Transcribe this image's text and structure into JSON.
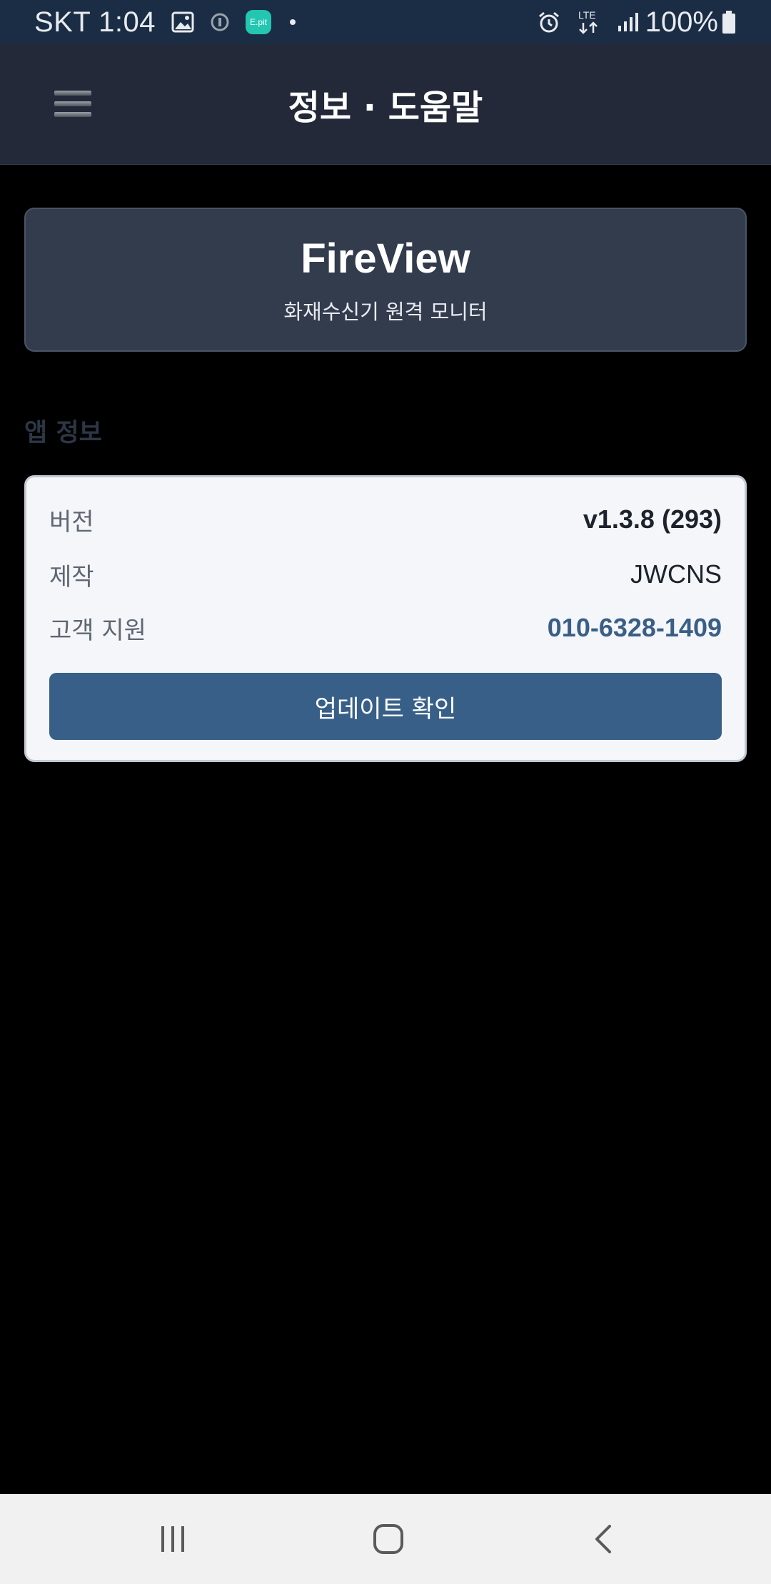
{
  "status_bar": {
    "carrier_time": "SKT 1:04",
    "epit_label": "E.pit",
    "network": "LTE",
    "battery": "100%"
  },
  "app_bar": {
    "title": "정보 · 도움말",
    "menu_icon": "hamburger-menu-icon"
  },
  "hero": {
    "app_name": "FireView",
    "subtitle": "화재수신기 원격 모니터"
  },
  "app_info": {
    "section_title": "앱 정보",
    "rows": [
      {
        "label": "버전",
        "value": "v1.3.8 (293)"
      },
      {
        "label": "제작",
        "value": "JWCNS"
      },
      {
        "label": "고객 지원",
        "value": "010-6328-1409"
      }
    ],
    "update_button_label": "업데이트 확인"
  },
  "colors": {
    "status_bar_bg": "#1b2d44",
    "app_bar_bg": "#232938",
    "hero_bg": "#333c4d",
    "card_bg": "#f4f6f9",
    "accent": "#375f88",
    "link": "#3a5f86"
  },
  "nav_bar": {
    "icons": [
      "recents-icon",
      "home-icon",
      "back-icon"
    ]
  }
}
